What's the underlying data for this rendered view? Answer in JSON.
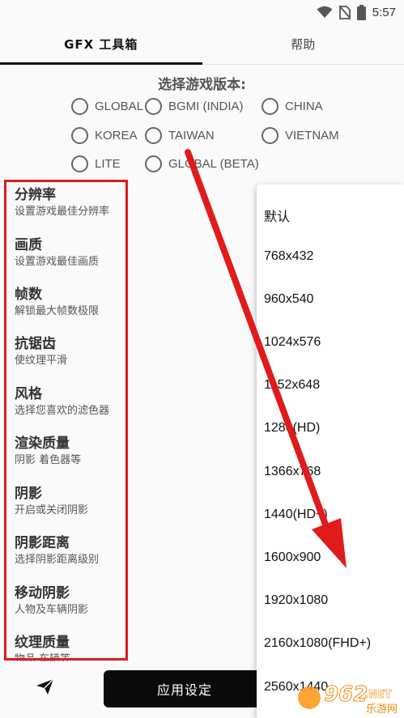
{
  "status_bar": {
    "time": "5:57"
  },
  "tabs": [
    {
      "label": "GFX 工具箱",
      "active": true
    },
    {
      "label": "帮助",
      "active": false
    }
  ],
  "version": {
    "title": "选择游戏版本:",
    "options": [
      "GLOBAL",
      "BGMI (INDIA)",
      "CHINA",
      "KOREA",
      "TAIWAN",
      "VIETNAM",
      "LITE",
      "GLOBAL (BETA)"
    ]
  },
  "settings": [
    {
      "title": "分辨率",
      "desc": "设置游戏最佳分辨率"
    },
    {
      "title": "画质",
      "desc": "设置游戏最佳画质"
    },
    {
      "title": "帧数",
      "desc": "解锁最大帧数极限"
    },
    {
      "title": "抗锯齿",
      "desc": "使纹理平滑"
    },
    {
      "title": "风格",
      "desc": "选择您喜欢的滤色器"
    },
    {
      "title": "渲染质量",
      "desc": "阴影 着色器等"
    },
    {
      "title": "阴影",
      "desc": "开启或关闭阴影"
    },
    {
      "title": "阴影距离",
      "desc": "选择阴影距离级别"
    },
    {
      "title": "移动阴影",
      "desc": "人物及车辆阴影"
    },
    {
      "title": "纹理质量",
      "desc": "物品 车辆等"
    }
  ],
  "apply_button": {
    "label": "应用设定"
  },
  "resolution_menu": {
    "options": [
      "默认",
      "768x432",
      "960x540",
      "1024x576",
      "1152x648",
      "1280(HD)",
      "1366x768",
      "1440(HD+)",
      "1600x900",
      "1920x1080",
      "2160x1080(FHD+)",
      "2560x1440"
    ]
  },
  "watermark": {
    "number": "962",
    "suffix": ".NET",
    "caption": "乐游网"
  },
  "colors": {
    "annotation_red": "#e01b1b",
    "button_bg": "#0b0b0b"
  },
  "icons": {
    "wifi": "wifi-icon",
    "no_sim": "no-sim-icon",
    "battery": "battery-icon",
    "send": "send-icon"
  }
}
